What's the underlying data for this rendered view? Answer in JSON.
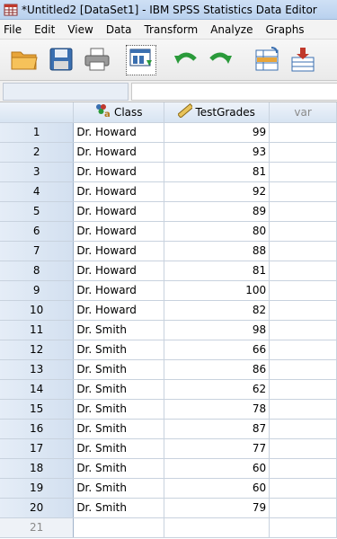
{
  "window": {
    "title": "*Untitled2 [DataSet1] - IBM SPSS Statistics Data Editor"
  },
  "menu": [
    {
      "label": "File"
    },
    {
      "label": "Edit"
    },
    {
      "label": "View"
    },
    {
      "label": "Data"
    },
    {
      "label": "Transform"
    },
    {
      "label": "Analyze"
    },
    {
      "label": "Graphs"
    }
  ],
  "toolbar": {
    "buttons": [
      {
        "icon": "open-folder-icon"
      },
      {
        "icon": "save-disk-icon"
      },
      {
        "icon": "print-icon"
      },
      {
        "icon": "dialog-recall-icon"
      },
      {
        "icon": "undo-icon"
      },
      {
        "icon": "redo-icon"
      },
      {
        "icon": "go-to-case-icon"
      },
      {
        "icon": "go-to-variable-icon"
      }
    ]
  },
  "cell_editor": {
    "name": "",
    "value": ""
  },
  "grid": {
    "columns": [
      {
        "label": "Class",
        "icon": "nominal-string-icon"
      },
      {
        "label": "TestGrades",
        "icon": "scale-ruler-icon"
      },
      {
        "label": "var"
      }
    ],
    "rows": [
      {
        "num": "1",
        "class": "Dr. Howard",
        "grade": "99"
      },
      {
        "num": "2",
        "class": "Dr. Howard",
        "grade": "93"
      },
      {
        "num": "3",
        "class": "Dr. Howard",
        "grade": "81"
      },
      {
        "num": "4",
        "class": "Dr. Howard",
        "grade": "92"
      },
      {
        "num": "5",
        "class": "Dr. Howard",
        "grade": "89"
      },
      {
        "num": "6",
        "class": "Dr. Howard",
        "grade": "80"
      },
      {
        "num": "7",
        "class": "Dr. Howard",
        "grade": "88"
      },
      {
        "num": "8",
        "class": "Dr. Howard",
        "grade": "81"
      },
      {
        "num": "9",
        "class": "Dr. Howard",
        "grade": "100"
      },
      {
        "num": "10",
        "class": "Dr. Howard",
        "grade": "82"
      },
      {
        "num": "11",
        "class": "Dr. Smith",
        "grade": "98"
      },
      {
        "num": "12",
        "class": "Dr. Smith",
        "grade": "66"
      },
      {
        "num": "13",
        "class": "Dr. Smith",
        "grade": "86"
      },
      {
        "num": "14",
        "class": "Dr. Smith",
        "grade": "62"
      },
      {
        "num": "15",
        "class": "Dr. Smith",
        "grade": "78"
      },
      {
        "num": "16",
        "class": "Dr. Smith",
        "grade": "87"
      },
      {
        "num": "17",
        "class": "Dr. Smith",
        "grade": "77"
      },
      {
        "num": "18",
        "class": "Dr. Smith",
        "grade": "60"
      },
      {
        "num": "19",
        "class": "Dr. Smith",
        "grade": "60"
      },
      {
        "num": "20",
        "class": "Dr. Smith",
        "grade": "79"
      }
    ],
    "empty_row": {
      "num": "21"
    }
  }
}
